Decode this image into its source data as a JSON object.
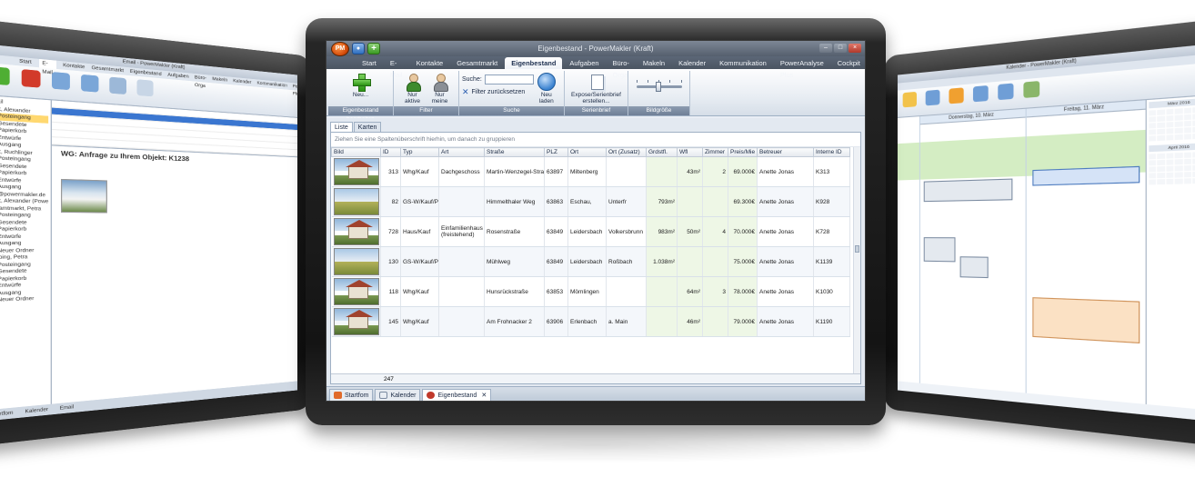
{
  "center": {
    "window_title": "Eigenbestand - PowerMakler (Kraft)",
    "app_logo": "PM",
    "tabs": [
      "Start",
      "E-Mail",
      "Kontakte",
      "Gesamtmarkt",
      "Eigenbestand",
      "Aufgaben",
      "Büro-Orga",
      "Makeln",
      "Kalender",
      "Kommunikation",
      "PowerAnalyse Plus",
      "Cockpit"
    ],
    "active_tab": "Eigenbestand",
    "ribbon": {
      "new_label": "Neu...",
      "group_edit": "Eigenbestand bearbeiten",
      "only_active": "Nur aktive",
      "only_mine": "Nur meine",
      "group_filter": "Filter",
      "search_label": "Suche:",
      "search_value": "",
      "filter_reset": "Filter zurücksetzen",
      "reload": "Neu laden",
      "group_search": "Suche",
      "expose": "Expose/Serienbrief erstellen...",
      "group_serial": "Serienbrief",
      "group_imagesize": "Bildgröße"
    },
    "subtabs": [
      "Liste",
      "Karten"
    ],
    "group_hint": "Ziehen Sie eine Spaltenüberschrift hierhin, um danach zu gruppieren",
    "columns": [
      "Bild",
      "ID",
      "Typ",
      "Art",
      "Straße",
      "PLZ",
      "Ort",
      "Ort (Zusatz)",
      "Grdstfl.",
      "Wfl",
      "Zimmer",
      "Preis/Mie",
      "Betreuer",
      "Interne ID"
    ],
    "rows": [
      {
        "id": "313",
        "typ": "Whg/Kauf",
        "art": "Dachgeschoss",
        "strasse": "Martin-Wenzegel-Straße",
        "plz": "63897",
        "ort": "Miltenberg",
        "zusatz": "",
        "grdstfl": "",
        "wfl": "43m²",
        "zimmer": "2",
        "preis": "69.000€",
        "betreuer": "Anette Jonas",
        "interne": "K313"
      },
      {
        "id": "82",
        "typ": "GS-W/Kauf/Pa",
        "art": "",
        "strasse": "Himmelthaler Weg",
        "plz": "63863",
        "ort": "Eschau,",
        "zusatz": "Unterfr",
        "grdstfl": "793m²",
        "wfl": "",
        "zimmer": "",
        "preis": "69.300€",
        "betreuer": "Anette Jonas",
        "interne": "K928"
      },
      {
        "id": "728",
        "typ": "Haus/Kauf",
        "art": "Einfamilienhaus (freistehend)",
        "strasse": "Rosenstraße",
        "plz": "63849",
        "ort": "Leidersbach",
        "zusatz": "Volkersbrunn",
        "grdstfl": "983m²",
        "wfl": "50m²",
        "zimmer": "4",
        "preis": "70.000€",
        "betreuer": "Anette Jonas",
        "interne": "K728"
      },
      {
        "id": "130",
        "typ": "GS-W/Kauf/Pa",
        "art": "",
        "strasse": "Mühlweg",
        "plz": "63849",
        "ort": "Leidersbach",
        "zusatz": "Roßbach",
        "grdstfl": "1.038m²",
        "wfl": "",
        "zimmer": "",
        "preis": "75.000€",
        "betreuer": "Anette Jonas",
        "interne": "K1139"
      },
      {
        "id": "118",
        "typ": "Whg/Kauf",
        "art": "",
        "strasse": "Hunsrückstraße",
        "plz": "63853",
        "ort": "Mömlingen",
        "zusatz": "",
        "grdstfl": "",
        "wfl": "64m²",
        "zimmer": "3",
        "preis": "78.000€",
        "betreuer": "Anette Jonas",
        "interne": "K1030"
      },
      {
        "id": "145",
        "typ": "Whg/Kauf",
        "art": "",
        "strasse": "Am Frohnacker 2",
        "plz": "63906",
        "ort": "Erlenbach",
        "zusatz": "a. Main",
        "grdstfl": "",
        "wfl": "46m²",
        "zimmer": "",
        "preis": "79.000€",
        "betreuer": "Anette Jonas",
        "interne": "K1190"
      }
    ],
    "record_count": "247",
    "doc_tabs": [
      "Startfom",
      "Kalender",
      "Eigenbestand"
    ]
  },
  "left": {
    "window_title": "Email - PowerMakler (Kraft)",
    "tabs": [
      "Start",
      "E-Mail",
      "Kontakte",
      "Gesamtmarkt",
      "Eigenbestand",
      "Aufgaben",
      "Büro-Orga",
      "Makeln",
      "Kalender",
      "Kommunikation",
      "PowerAnalyse Plus"
    ],
    "tree": [
      "Email",
      "Kraft, Alexander",
      "Posteingang",
      "Gesendete",
      "Papierkorb",
      "Entwürfe",
      "Ausgang",
      "Kraft, Ruchlinger",
      "Posteingang",
      "Gesendete",
      "Papierkorb",
      "Entwürfe",
      "Ausgang",
      "info@powermakler.de",
      "Kraft, Alexander (Powermakler)",
      "Gesamtmarkt, Petra",
      "Posteingang",
      "Gesendete",
      "Papierkorb",
      "Entwürfe",
      "Ausgang",
      "Neuer Ordner",
      "Kapping, Petra",
      "Posteingang",
      "Gesendete",
      "Papierkorb",
      "Entwürfe",
      "Ausgang",
      "Neuer Ordner"
    ],
    "mail_subject": "WG: Anfrage zu Ihrem Objekt: K1238",
    "status": [
      "Startfom",
      "Kalender",
      "Email"
    ]
  },
  "right": {
    "window_title": "Kalender - PowerMakler (Kraft)",
    "days": [
      "Donnerstag, 10. März",
      "Freitag, 11. März"
    ],
    "minical_titles": [
      "März 2016",
      "April 2016"
    ]
  }
}
